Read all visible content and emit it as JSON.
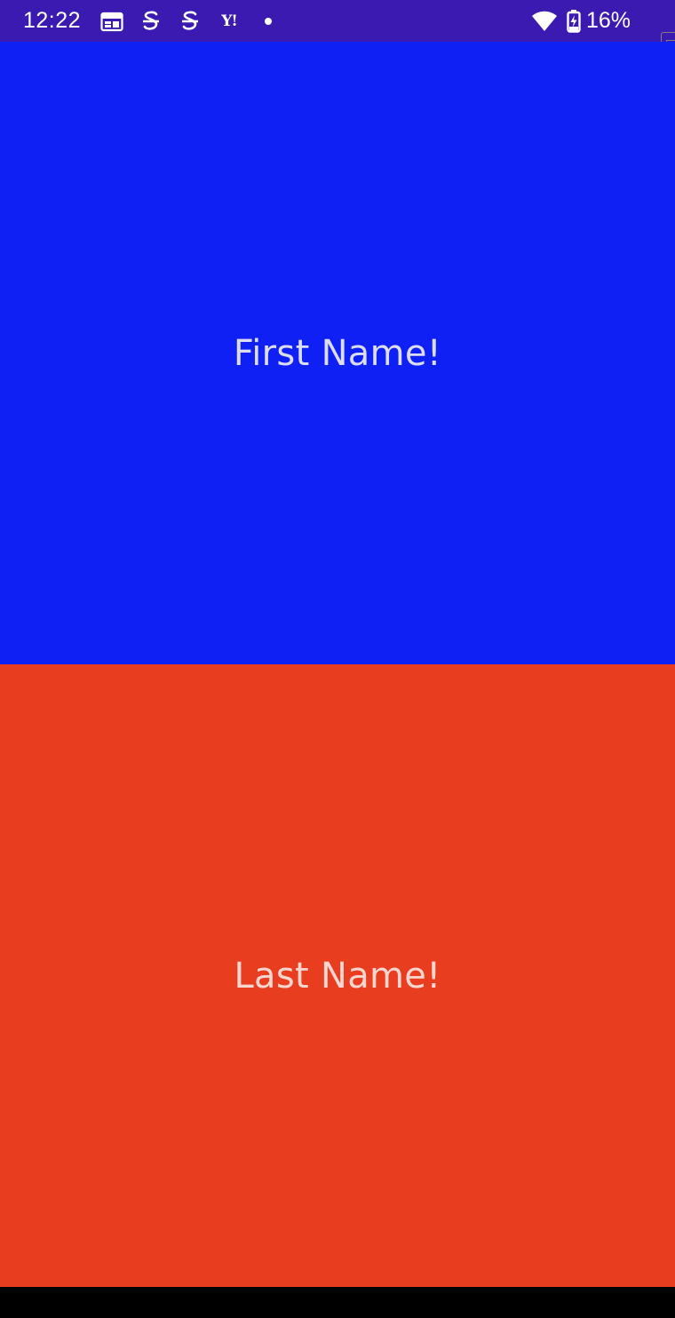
{
  "status_bar": {
    "time": "12:22",
    "background_color": "#3a1ab0",
    "notification_icons": [
      "calendar-icon",
      "s-app-icon",
      "s-app-icon",
      "yahoo-icon",
      "more-notifications-dot-icon"
    ],
    "yahoo_label": "Y!",
    "wifi_icon": "wifi-icon",
    "battery_icon": "battery-charging-icon",
    "battery_percent": "16%"
  },
  "top_panel": {
    "label": "First Name!",
    "color": "#0f20f5"
  },
  "bottom_panel": {
    "label": "Last Name!",
    "color": "#e93d20"
  },
  "navigation_bar": {
    "color": "#000000"
  }
}
